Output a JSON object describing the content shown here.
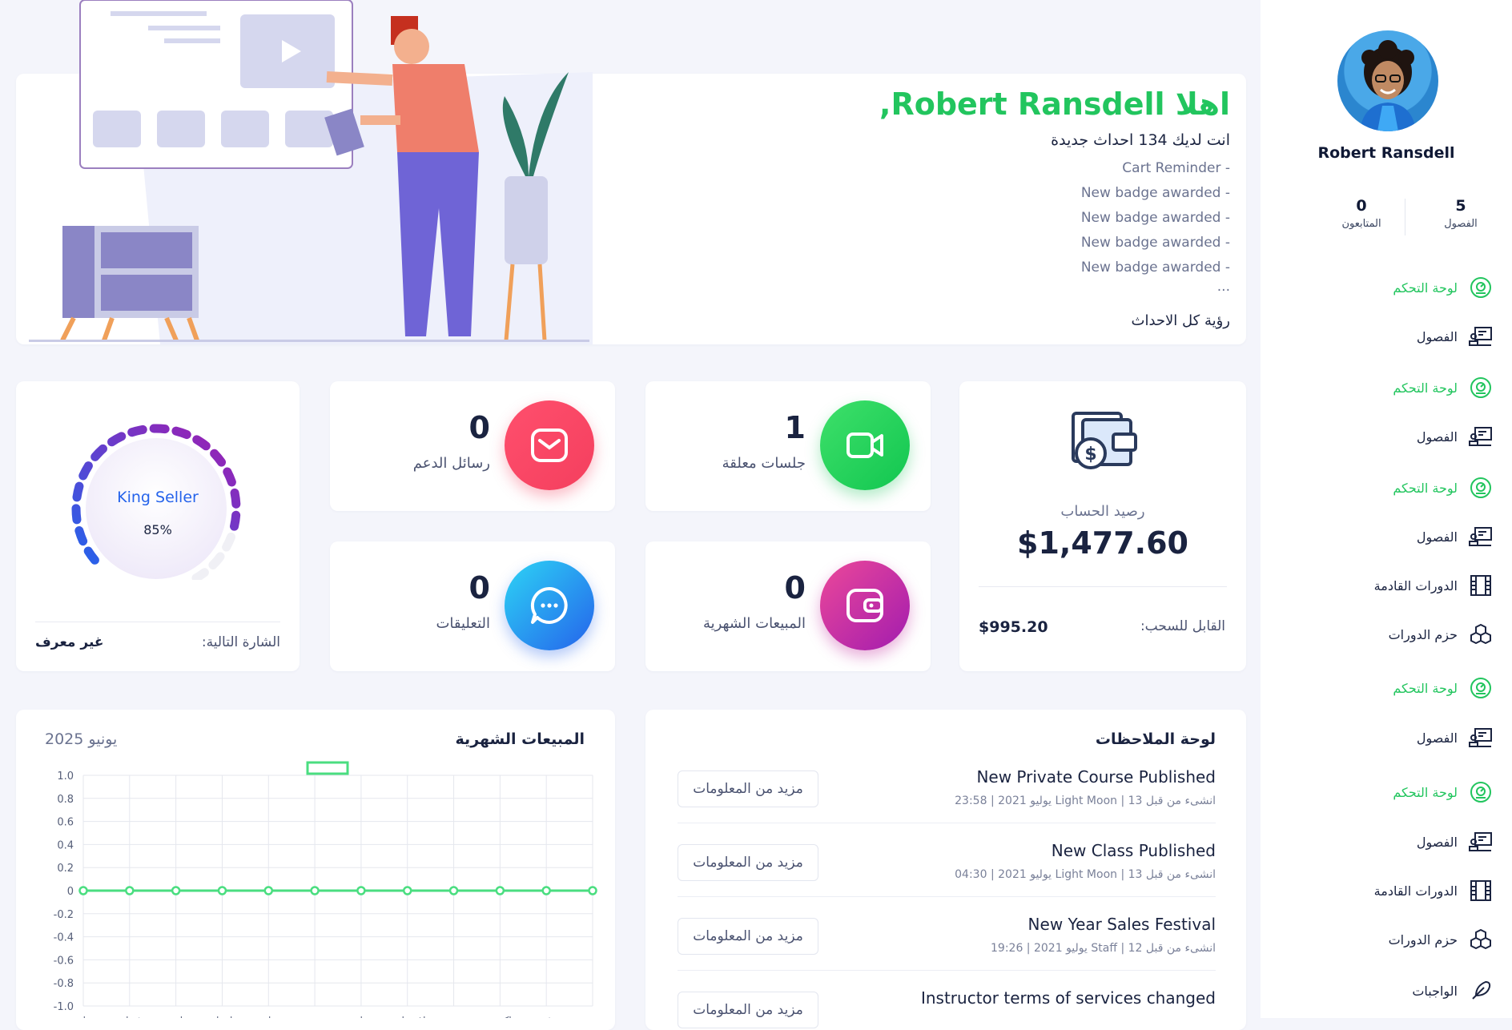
{
  "sidebar": {
    "user_name": "Robert Ransdell",
    "stats": [
      {
        "value": "5",
        "label": "الفصول"
      },
      {
        "value": "0",
        "label": "المتابعون"
      }
    ],
    "nav": [
      {
        "label": "لوحة التحكم",
        "icon": "dashboard-icon",
        "active": true
      },
      {
        "label": "الفصول",
        "icon": "classes-icon",
        "active": false
      },
      {
        "label": "لوحة التحكم",
        "icon": "dashboard-icon",
        "active": true
      },
      {
        "label": "الفصول",
        "icon": "classes-icon",
        "active": false
      },
      {
        "label": "لوحة التحكم",
        "icon": "dashboard-icon",
        "active": true
      },
      {
        "label": "الفصول",
        "icon": "classes-icon",
        "active": false
      },
      {
        "label": "الدورات القادمة",
        "icon": "film-icon",
        "active": false
      },
      {
        "label": "حزم الدورات",
        "icon": "cubes-icon",
        "active": false
      },
      {
        "label": "لوحة التحكم",
        "icon": "dashboard-icon",
        "active": true
      },
      {
        "label": "الفصول",
        "icon": "classes-icon",
        "active": false
      },
      {
        "label": "لوحة التحكم",
        "icon": "dashboard-icon",
        "active": true
      },
      {
        "label": "الفصول",
        "icon": "classes-icon",
        "active": false
      },
      {
        "label": "الدورات القادمة",
        "icon": "film-icon",
        "active": false
      },
      {
        "label": "حزم الدورات",
        "icon": "cubes-icon",
        "active": false
      },
      {
        "label": "الواجبات",
        "icon": "feather-icon",
        "active": false
      }
    ]
  },
  "welcome": {
    "title": "اهلا Robert Ransdell,",
    "subtitle": "انت لديك 134 احداث جديدة",
    "events": [
      "Cart Reminder -",
      "New badge awarded -",
      "New badge awarded -",
      "New badge awarded -",
      "New badge awarded -"
    ],
    "ellipsis": "...",
    "see_all": "رؤية كل الاحداث"
  },
  "balance": {
    "label": "رصيد الحساب",
    "amount": "$1,477.60",
    "withdrawable_label": "القابل للسحب:",
    "withdrawable_amount": "$995.20"
  },
  "stats_cards": {
    "pending_sessions": {
      "value": "1",
      "label": "جلسات معلقة"
    },
    "support_messages": {
      "value": "0",
      "label": "رسائل الدعم"
    },
    "monthly_sales": {
      "value": "0",
      "label": "المبيعات الشهرية"
    },
    "comments": {
      "value": "0",
      "label": "التعليقات"
    }
  },
  "badge": {
    "name": "King Seller",
    "percent_text": "85%",
    "progress": 0.85,
    "next_label": "الشارة التالية:",
    "next_value": "غير معرف"
  },
  "sales_chart": {
    "title": "المبيعات الشهرية",
    "period": "يونيو 2025"
  },
  "chart_data": {
    "type": "line",
    "categories": [
      "يناير",
      "فبراير",
      "مارس",
      "ابريل",
      "مايو",
      "يونيو",
      "يوليو",
      "اغسطس",
      "سبتمبر",
      "اكتوبر",
      "نوفمبر",
      "ديسمبر"
    ],
    "series": [
      {
        "values": [
          0,
          0,
          0,
          0,
          0,
          0,
          0,
          0,
          0,
          0,
          0,
          0
        ]
      }
    ],
    "ylim": [
      -1.0,
      1.0
    ],
    "y_ticks": [
      "1.0",
      "0.8",
      "0.6",
      "0.4",
      "0.2",
      "0",
      "-0.2",
      "-0.4",
      "-0.6",
      "-0.8",
      "-1.0"
    ],
    "grid": true,
    "color": "#4ade80"
  },
  "notices": {
    "title": "لوحة الملاحظات",
    "more_label": "مزيد من المعلومات",
    "items": [
      {
        "title": "New Private Course Published",
        "meta": "انشىء من قبل  Light Moon | 13 يوليو 2021 | 23:58"
      },
      {
        "title": "New Class Published",
        "meta": "انشىء من قبل  Light Moon | 13 يوليو 2021 | 04:30"
      },
      {
        "title": "New Year Sales Festival",
        "meta": "انشىء من قبل  Staff | 12 يوليو 2021 | 19:26"
      },
      {
        "title": "Instructor terms of services changed",
        "meta": ""
      }
    ]
  },
  "colors": {
    "accent": "#22c55e",
    "text": "#1a2340"
  }
}
